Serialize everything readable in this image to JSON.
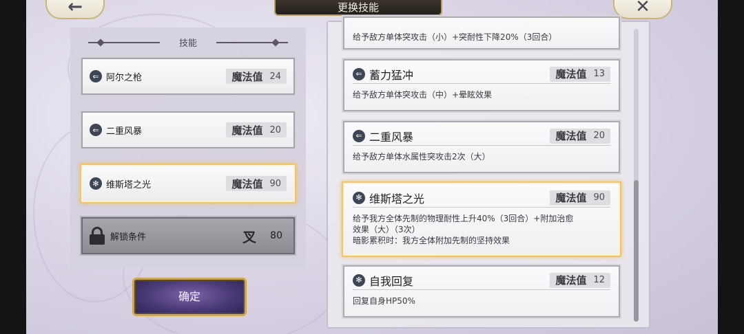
{
  "title": "更换技能",
  "nav": {
    "back_icon": "←",
    "close_icon": "✕"
  },
  "left_panel": {
    "header": "技能",
    "slots": [
      {
        "name": "阿尔之枪",
        "mp_label": "魔法值",
        "mp": "24",
        "icon": "arrow-icon"
      },
      {
        "name": "二重风暴",
        "mp_label": "魔法值",
        "mp": "20",
        "icon": "arrow-icon"
      },
      {
        "name": "维斯塔之光",
        "mp_label": "魔法值",
        "mp": "90",
        "icon": "snowflake-icon"
      }
    ],
    "locked": {
      "label": "解锁条件",
      "value": "80",
      "icon_glyph": "叉"
    }
  },
  "confirm_label": "确定",
  "skill_list": [
    {
      "name": "",
      "mp_label": "",
      "mp": "",
      "desc": "给予敌方单体突攻击（小）+突耐性下降20%（3回合）"
    },
    {
      "name": "蓄力猛冲",
      "mp_label": "魔法值",
      "mp": "13",
      "desc": "给予敌方单体突攻击（中）+晕眩效果"
    },
    {
      "name": "二重风暴",
      "mp_label": "魔法值",
      "mp": "20",
      "desc": "给予敌方单体水属性突攻击2次（大）"
    },
    {
      "name": "维斯塔之光",
      "mp_label": "魔法值",
      "mp": "90",
      "desc_line1": "给予我方全体先制的物理耐性上升40%（3回合）+附加治愈",
      "desc_line2": "效果（大）（3次）",
      "desc_line3": "暗影累积时：我方全体附加先制的坚持效果"
    },
    {
      "name": "自我回复",
      "mp_label": "魔法值",
      "mp": "12",
      "desc": "回复自身HP50%"
    }
  ],
  "colors": {
    "accent_gold": "#f0c46a",
    "confirm_purple": "#4a3a78"
  }
}
